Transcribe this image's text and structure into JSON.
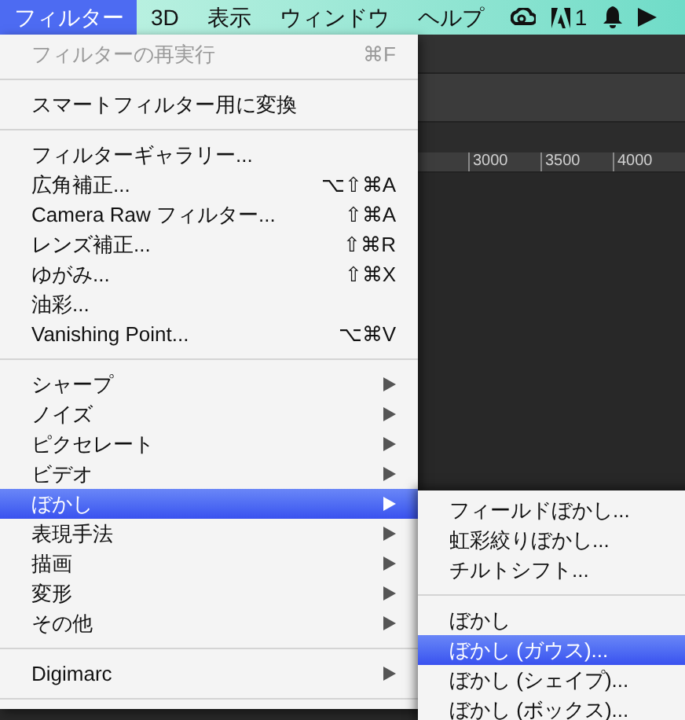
{
  "menubar": {
    "items": [
      {
        "label": "フィルター",
        "selected": true
      },
      {
        "label": "3D",
        "selected": false
      },
      {
        "label": "表示",
        "selected": false
      },
      {
        "label": "ウィンドウ",
        "selected": false
      },
      {
        "label": "ヘルプ",
        "selected": false
      }
    ],
    "adobe_count": "1"
  },
  "ruler": {
    "labels": [
      "3000",
      "3500",
      "4000"
    ]
  },
  "menu": {
    "items": [
      {
        "kind": "item",
        "label": "フィルターの再実行",
        "shortcut": "⌘F",
        "disabled": true,
        "selected": false
      },
      {
        "kind": "separator"
      },
      {
        "kind": "item",
        "label": "スマートフィルター用に変換",
        "disabled": false,
        "selected": false
      },
      {
        "kind": "separator"
      },
      {
        "kind": "item",
        "label": "フィルターギャラリー...",
        "disabled": false,
        "selected": false
      },
      {
        "kind": "item",
        "label": "広角補正...",
        "shortcut": "⌥⇧⌘A",
        "disabled": false,
        "selected": false
      },
      {
        "kind": "item",
        "label": "Camera Raw フィルター...",
        "shortcut": "⇧⌘A",
        "disabled": false,
        "selected": false
      },
      {
        "kind": "item",
        "label": "レンズ補正...",
        "shortcut": "⇧⌘R",
        "disabled": false,
        "selected": false
      },
      {
        "kind": "item",
        "label": "ゆがみ...",
        "shortcut": "⇧⌘X",
        "disabled": false,
        "selected": false
      },
      {
        "kind": "item",
        "label": "油彩...",
        "disabled": false,
        "selected": false
      },
      {
        "kind": "item",
        "label": "Vanishing Point...",
        "shortcut": "⌥⌘V",
        "disabled": false,
        "selected": false
      },
      {
        "kind": "separator"
      },
      {
        "kind": "submenu",
        "label": "シャープ",
        "disabled": false,
        "selected": false
      },
      {
        "kind": "submenu",
        "label": "ノイズ",
        "disabled": false,
        "selected": false
      },
      {
        "kind": "submenu",
        "label": "ピクセレート",
        "disabled": false,
        "selected": false
      },
      {
        "kind": "submenu",
        "label": "ビデオ",
        "disabled": false,
        "selected": false
      },
      {
        "kind": "submenu",
        "label": "ぼかし",
        "disabled": false,
        "selected": true
      },
      {
        "kind": "submenu",
        "label": "表現手法",
        "disabled": false,
        "selected": false
      },
      {
        "kind": "submenu",
        "label": "描画",
        "disabled": false,
        "selected": false
      },
      {
        "kind": "submenu",
        "label": "変形",
        "disabled": false,
        "selected": false
      },
      {
        "kind": "submenu",
        "label": "その他",
        "disabled": false,
        "selected": false
      },
      {
        "kind": "separator"
      },
      {
        "kind": "submenu",
        "label": "Digimarc",
        "disabled": false,
        "selected": false
      },
      {
        "kind": "separator"
      }
    ]
  },
  "submenu": {
    "items": [
      {
        "kind": "item",
        "label": "フィールドぼかし...",
        "selected": false
      },
      {
        "kind": "item",
        "label": "虹彩絞りぼかし...",
        "selected": false
      },
      {
        "kind": "item",
        "label": "チルトシフト...",
        "selected": false
      },
      {
        "kind": "separator"
      },
      {
        "kind": "item",
        "label": "ぼかし",
        "selected": false
      },
      {
        "kind": "item",
        "label": "ぼかし (ガウス)...",
        "selected": true
      },
      {
        "kind": "item",
        "label": "ぼかし (シェイプ)...",
        "selected": false
      },
      {
        "kind": "item",
        "label": "ぼかし (ボックス)...",
        "selected": false
      }
    ]
  }
}
